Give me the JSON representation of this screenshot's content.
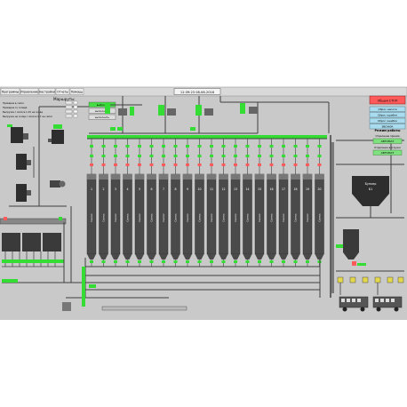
{
  "menu": [
    "Программы",
    "Управление",
    "Настройки",
    "Отчеты",
    "Помощь"
  ],
  "datetime": "12:39:23 08-08-2016",
  "routes": {
    "title": "Маршруты",
    "rows": [
      "Проверка в силос",
      "Проверка со склада",
      "Выгрузка с силоса 1-15 на склад",
      "Выгрузка на склад с силоса 1-7 на силос"
    ],
    "buttons": [
      "выбрано",
      "выполнить",
      "выполнить"
    ]
  },
  "right_panel": {
    "alarm": "Общая СТОП",
    "buttons": [
      "Сброс насоса",
      "Сброс ошибок",
      "Сброс ошибок",
      "ЗВОНОК"
    ],
    "mode_title": "Режим работы",
    "mode_rows": [
      {
        "label": "Отделение приема",
        "value": "АВТОМАТ"
      },
      {
        "label": "Отделение выгрузки",
        "value": "АВТОМАТ"
      }
    ]
  },
  "silos": [
    {
      "num": "1",
      "text": "Силос"
    },
    {
      "num": "2",
      "text": "Силос"
    },
    {
      "num": "3",
      "text": "Силос"
    },
    {
      "num": "4",
      "text": "Силос"
    },
    {
      "num": "5",
      "text": "Силос"
    },
    {
      "num": "6",
      "text": "Силос"
    },
    {
      "num": "7",
      "text": "Силос"
    },
    {
      "num": "8",
      "text": "Силос"
    },
    {
      "num": "9",
      "text": "Силос"
    },
    {
      "num": "10",
      "text": "Силос"
    },
    {
      "num": "11",
      "text": "Силос"
    },
    {
      "num": "12",
      "text": "Силос"
    },
    {
      "num": "13",
      "text": "Силос"
    },
    {
      "num": "14",
      "text": "Силос"
    },
    {
      "num": "15",
      "text": "Силос"
    },
    {
      "num": "16",
      "text": "Силос"
    },
    {
      "num": "17",
      "text": "Силос"
    },
    {
      "num": "18",
      "text": "Силос"
    },
    {
      "num": "19",
      "text": "Силос"
    },
    {
      "num": "20",
      "text": "Силос"
    }
  ],
  "bunker": {
    "label": "Бункер",
    "num": "Б1"
  },
  "colors": {
    "background": "#c9c9c9",
    "pipe": "#404040",
    "active": "#33dd33",
    "alarm": "#ff5a5a",
    "panel_btn": "#a9dcee"
  }
}
